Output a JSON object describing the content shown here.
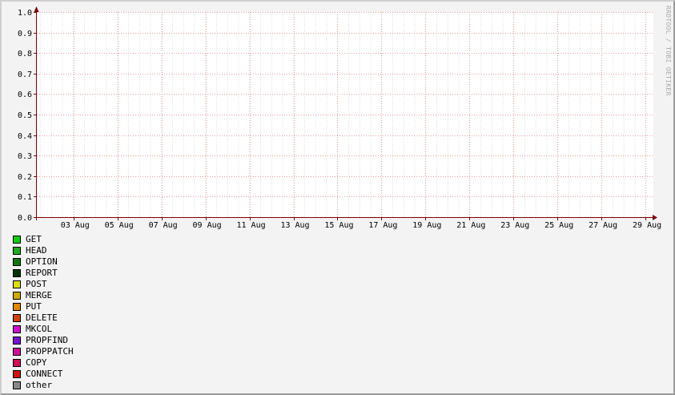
{
  "chart_data": {
    "type": "area",
    "title": "",
    "xlabel": "",
    "ylabel": "",
    "ylim": [
      0,
      1.0
    ],
    "yticks": [
      "0.0",
      "0.1",
      "0.2",
      "0.3",
      "0.4",
      "0.5",
      "0.6",
      "0.7",
      "0.8",
      "0.9",
      "1.0"
    ],
    "xticks": [
      "03 Aug",
      "05 Aug",
      "07 Aug",
      "09 Aug",
      "11 Aug",
      "13 Aug",
      "15 Aug",
      "17 Aug",
      "19 Aug",
      "21 Aug",
      "23 Aug",
      "25 Aug",
      "27 Aug",
      "29 Aug"
    ],
    "grid": true,
    "legend_position": "bottom-left",
    "series": [
      {
        "name": "GET",
        "color": "#11cc11",
        "values": []
      },
      {
        "name": "HEAD",
        "color": "#22aa22",
        "values": []
      },
      {
        "name": "OPTION",
        "color": "#117711",
        "values": []
      },
      {
        "name": "REPORT",
        "color": "#003300",
        "values": []
      },
      {
        "name": "POST",
        "color": "#dddd11",
        "values": []
      },
      {
        "name": "MERGE",
        "color": "#ccaa00",
        "values": []
      },
      {
        "name": "PUT",
        "color": "#dd8800",
        "values": []
      },
      {
        "name": "DELETE",
        "color": "#cc4411",
        "values": []
      },
      {
        "name": "MKCOL",
        "color": "#cc11cc",
        "values": []
      },
      {
        "name": "PROPFIND",
        "color": "#7711cc",
        "values": []
      },
      {
        "name": "PROPPATCH",
        "color": "#cc1199",
        "values": []
      },
      {
        "name": "COPY",
        "color": "#cc1155",
        "values": []
      },
      {
        "name": "CONNECT",
        "color": "#cc1111",
        "values": []
      },
      {
        "name": "other",
        "color": "#888888",
        "values": []
      }
    ]
  },
  "watermark": "RRDTOOL / TOBI OETIKER",
  "colors": {
    "canvas": "#ffffff",
    "background": "#f3f3f3",
    "major_grid": "#e8a0a0",
    "minor_grid": "#dddddd",
    "axis": "#800000"
  }
}
